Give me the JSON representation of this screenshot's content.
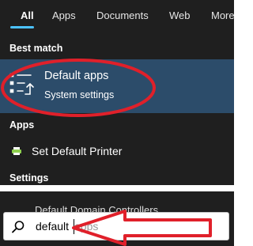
{
  "tabs": [
    "All",
    "Apps",
    "Documents",
    "Web",
    "More"
  ],
  "sections": {
    "best_match": "Best match",
    "apps": "Apps",
    "settings": "Settings"
  },
  "best_match": {
    "title": "Default apps",
    "subtitle": "System settings",
    "icon": "default-apps-icon"
  },
  "apps": [
    {
      "label": "Set Default Printer",
      "icon": "printer-icon"
    }
  ],
  "settings": [
    {
      "label": "Default Domain Controllers"
    }
  ],
  "search": {
    "typed": "default",
    "suggestion": "apps"
  },
  "annotations": {
    "highlight_color": "#e0202a"
  },
  "colors": {
    "panel_bg": "#1f1f1f",
    "selected_bg": "#2c4c6a",
    "accent": "#4cc2ff"
  }
}
